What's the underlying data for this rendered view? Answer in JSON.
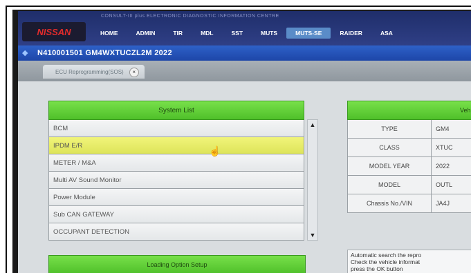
{
  "app": {
    "strip_text": "CONSULT-III plus  ELECTRONIC DIAGNOSTIC INFORMATION CENTRE",
    "logo_text": "NISSAN"
  },
  "nav": {
    "items": [
      "HOME",
      "ADMIN",
      "TIR",
      "MDL",
      "SST",
      "MUTS",
      "MUTS-SE",
      "RAIDER",
      "ASA"
    ],
    "active_index": 6
  },
  "titlebar": {
    "text": "N410001501   GM4WXTUCZL2M 2022"
  },
  "tab": {
    "label": "ECU Reprogramming(SOS)",
    "close_symbol": "×"
  },
  "system_list": {
    "header": "System List",
    "items": [
      "BCM",
      "IPDM E/R",
      "METER / M&A",
      "Multi AV Sound Monitor",
      "Power Module",
      "Sub CAN GATEWAY",
      "OCCUPANT DETECTION"
    ],
    "selected_index": 1,
    "loading_label": "Loading Option Setup"
  },
  "vehicle_info": {
    "header": "Vehic",
    "rows": [
      {
        "key": "TYPE",
        "value": "GM4"
      },
      {
        "key": "CLASS",
        "value": "XTUC"
      },
      {
        "key": "MODEL YEAR",
        "value": "2022"
      },
      {
        "key": "MODEL",
        "value": "OUTL"
      },
      {
        "key": "Chassis No./VIN",
        "value": "JA4J"
      }
    ],
    "message": [
      "Automatic search the repro",
      "Check the vehicle informat",
      "press the OK button"
    ]
  },
  "colors": {
    "nav_bg": "#1f2e6a",
    "titlebar_bg": "#2e61c8",
    "header_green": "#5fcf36",
    "selected_row": "#e8ec66"
  }
}
